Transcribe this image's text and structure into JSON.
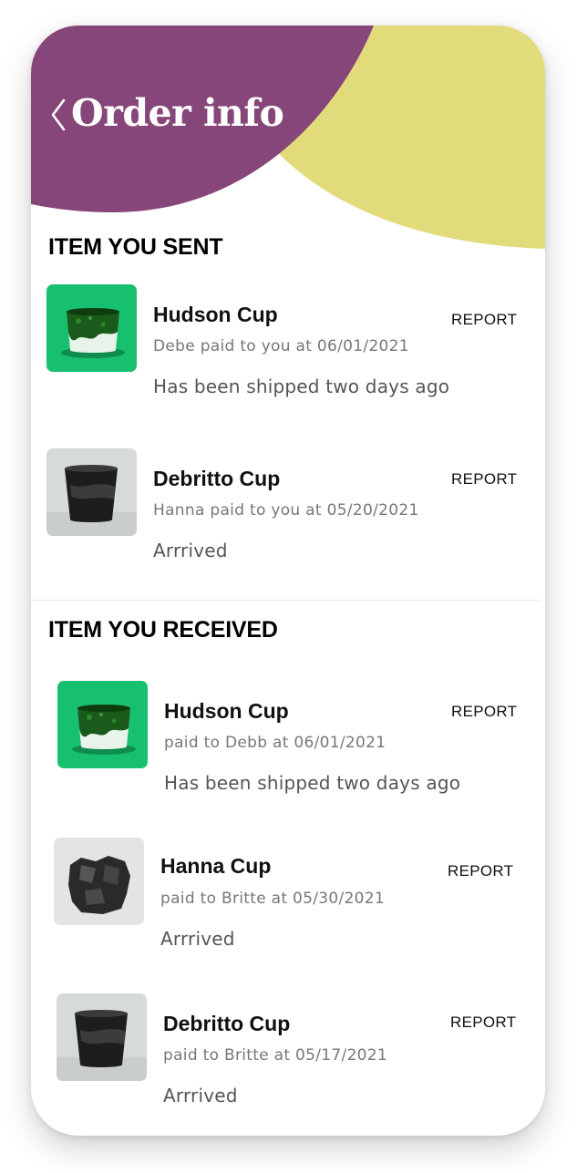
{
  "header": {
    "title": "Order info",
    "back_icon": "chevron-left-icon",
    "colors": {
      "purple": "#874679",
      "yellow": "#e2db7c"
    }
  },
  "sent": {
    "title": "ITEM YOU SENT",
    "items": [
      {
        "name": "Hudson Cup",
        "paid": "Debe paid to you at 06/01/2021",
        "status": "Has been shipped two days ago",
        "report": "REPORT",
        "image": "green-cup-photo"
      },
      {
        "name": "Debritto Cup",
        "paid": "Hanna paid to you at 05/20/2021",
        "status": "Arrrived",
        "report": "REPORT",
        "image": "black-cup-photo"
      }
    ]
  },
  "received": {
    "title": "ITEM YOU RECEIVED",
    "items": [
      {
        "name": "Hudson Cup",
        "paid": "paid to Debb at 06/01/2021",
        "status": "Has been shipped two days ago",
        "report": "REPORT",
        "image": "green-cup-photo"
      },
      {
        "name": "Hanna Cup",
        "paid": "paid to Britte at 05/30/2021",
        "status": "Arrrived",
        "report": "REPORT",
        "image": "rough-black-cup-photo"
      },
      {
        "name": "Debritto Cup",
        "paid": "paid to Britte at 05/17/2021",
        "status": "Arrrived",
        "report": "REPORT",
        "image": "black-cup-photo"
      }
    ]
  }
}
